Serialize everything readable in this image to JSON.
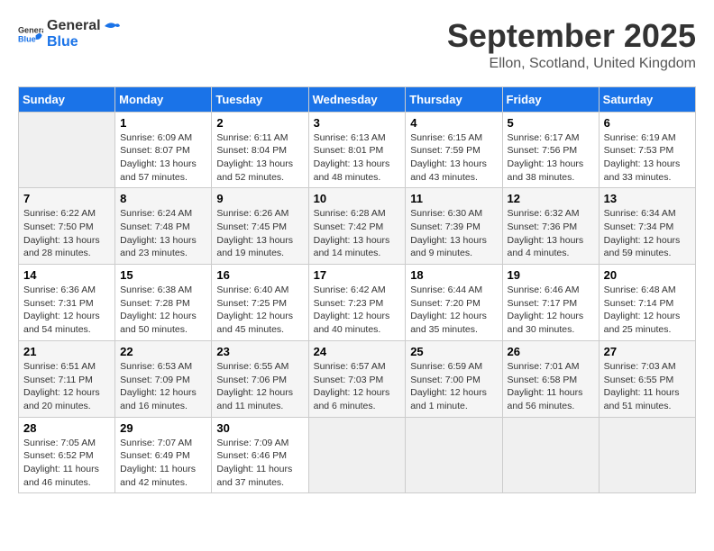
{
  "logo": {
    "general": "General",
    "blue": "Blue"
  },
  "title": "September 2025",
  "subtitle": "Ellon, Scotland, United Kingdom",
  "days_of_week": [
    "Sunday",
    "Monday",
    "Tuesday",
    "Wednesday",
    "Thursday",
    "Friday",
    "Saturday"
  ],
  "weeks": [
    [
      {
        "day": "",
        "sunrise": "",
        "sunset": "",
        "daylight": ""
      },
      {
        "day": "1",
        "sunrise": "Sunrise: 6:09 AM",
        "sunset": "Sunset: 8:07 PM",
        "daylight": "Daylight: 13 hours and 57 minutes."
      },
      {
        "day": "2",
        "sunrise": "Sunrise: 6:11 AM",
        "sunset": "Sunset: 8:04 PM",
        "daylight": "Daylight: 13 hours and 52 minutes."
      },
      {
        "day": "3",
        "sunrise": "Sunrise: 6:13 AM",
        "sunset": "Sunset: 8:01 PM",
        "daylight": "Daylight: 13 hours and 48 minutes."
      },
      {
        "day": "4",
        "sunrise": "Sunrise: 6:15 AM",
        "sunset": "Sunset: 7:59 PM",
        "daylight": "Daylight: 13 hours and 43 minutes."
      },
      {
        "day": "5",
        "sunrise": "Sunrise: 6:17 AM",
        "sunset": "Sunset: 7:56 PM",
        "daylight": "Daylight: 13 hours and 38 minutes."
      },
      {
        "day": "6",
        "sunrise": "Sunrise: 6:19 AM",
        "sunset": "Sunset: 7:53 PM",
        "daylight": "Daylight: 13 hours and 33 minutes."
      }
    ],
    [
      {
        "day": "7",
        "sunrise": "Sunrise: 6:22 AM",
        "sunset": "Sunset: 7:50 PM",
        "daylight": "Daylight: 13 hours and 28 minutes."
      },
      {
        "day": "8",
        "sunrise": "Sunrise: 6:24 AM",
        "sunset": "Sunset: 7:48 PM",
        "daylight": "Daylight: 13 hours and 23 minutes."
      },
      {
        "day": "9",
        "sunrise": "Sunrise: 6:26 AM",
        "sunset": "Sunset: 7:45 PM",
        "daylight": "Daylight: 13 hours and 19 minutes."
      },
      {
        "day": "10",
        "sunrise": "Sunrise: 6:28 AM",
        "sunset": "Sunset: 7:42 PM",
        "daylight": "Daylight: 13 hours and 14 minutes."
      },
      {
        "day": "11",
        "sunrise": "Sunrise: 6:30 AM",
        "sunset": "Sunset: 7:39 PM",
        "daylight": "Daylight: 13 hours and 9 minutes."
      },
      {
        "day": "12",
        "sunrise": "Sunrise: 6:32 AM",
        "sunset": "Sunset: 7:36 PM",
        "daylight": "Daylight: 13 hours and 4 minutes."
      },
      {
        "day": "13",
        "sunrise": "Sunrise: 6:34 AM",
        "sunset": "Sunset: 7:34 PM",
        "daylight": "Daylight: 12 hours and 59 minutes."
      }
    ],
    [
      {
        "day": "14",
        "sunrise": "Sunrise: 6:36 AM",
        "sunset": "Sunset: 7:31 PM",
        "daylight": "Daylight: 12 hours and 54 minutes."
      },
      {
        "day": "15",
        "sunrise": "Sunrise: 6:38 AM",
        "sunset": "Sunset: 7:28 PM",
        "daylight": "Daylight: 12 hours and 50 minutes."
      },
      {
        "day": "16",
        "sunrise": "Sunrise: 6:40 AM",
        "sunset": "Sunset: 7:25 PM",
        "daylight": "Daylight: 12 hours and 45 minutes."
      },
      {
        "day": "17",
        "sunrise": "Sunrise: 6:42 AM",
        "sunset": "Sunset: 7:23 PM",
        "daylight": "Daylight: 12 hours and 40 minutes."
      },
      {
        "day": "18",
        "sunrise": "Sunrise: 6:44 AM",
        "sunset": "Sunset: 7:20 PM",
        "daylight": "Daylight: 12 hours and 35 minutes."
      },
      {
        "day": "19",
        "sunrise": "Sunrise: 6:46 AM",
        "sunset": "Sunset: 7:17 PM",
        "daylight": "Daylight: 12 hours and 30 minutes."
      },
      {
        "day": "20",
        "sunrise": "Sunrise: 6:48 AM",
        "sunset": "Sunset: 7:14 PM",
        "daylight": "Daylight: 12 hours and 25 minutes."
      }
    ],
    [
      {
        "day": "21",
        "sunrise": "Sunrise: 6:51 AM",
        "sunset": "Sunset: 7:11 PM",
        "daylight": "Daylight: 12 hours and 20 minutes."
      },
      {
        "day": "22",
        "sunrise": "Sunrise: 6:53 AM",
        "sunset": "Sunset: 7:09 PM",
        "daylight": "Daylight: 12 hours and 16 minutes."
      },
      {
        "day": "23",
        "sunrise": "Sunrise: 6:55 AM",
        "sunset": "Sunset: 7:06 PM",
        "daylight": "Daylight: 12 hours and 11 minutes."
      },
      {
        "day": "24",
        "sunrise": "Sunrise: 6:57 AM",
        "sunset": "Sunset: 7:03 PM",
        "daylight": "Daylight: 12 hours and 6 minutes."
      },
      {
        "day": "25",
        "sunrise": "Sunrise: 6:59 AM",
        "sunset": "Sunset: 7:00 PM",
        "daylight": "Daylight: 12 hours and 1 minute."
      },
      {
        "day": "26",
        "sunrise": "Sunrise: 7:01 AM",
        "sunset": "Sunset: 6:58 PM",
        "daylight": "Daylight: 11 hours and 56 minutes."
      },
      {
        "day": "27",
        "sunrise": "Sunrise: 7:03 AM",
        "sunset": "Sunset: 6:55 PM",
        "daylight": "Daylight: 11 hours and 51 minutes."
      }
    ],
    [
      {
        "day": "28",
        "sunrise": "Sunrise: 7:05 AM",
        "sunset": "Sunset: 6:52 PM",
        "daylight": "Daylight: 11 hours and 46 minutes."
      },
      {
        "day": "29",
        "sunrise": "Sunrise: 7:07 AM",
        "sunset": "Sunset: 6:49 PM",
        "daylight": "Daylight: 11 hours and 42 minutes."
      },
      {
        "day": "30",
        "sunrise": "Sunrise: 7:09 AM",
        "sunset": "Sunset: 6:46 PM",
        "daylight": "Daylight: 11 hours and 37 minutes."
      },
      {
        "day": "",
        "sunrise": "",
        "sunset": "",
        "daylight": ""
      },
      {
        "day": "",
        "sunrise": "",
        "sunset": "",
        "daylight": ""
      },
      {
        "day": "",
        "sunrise": "",
        "sunset": "",
        "daylight": ""
      },
      {
        "day": "",
        "sunrise": "",
        "sunset": "",
        "daylight": ""
      }
    ]
  ]
}
